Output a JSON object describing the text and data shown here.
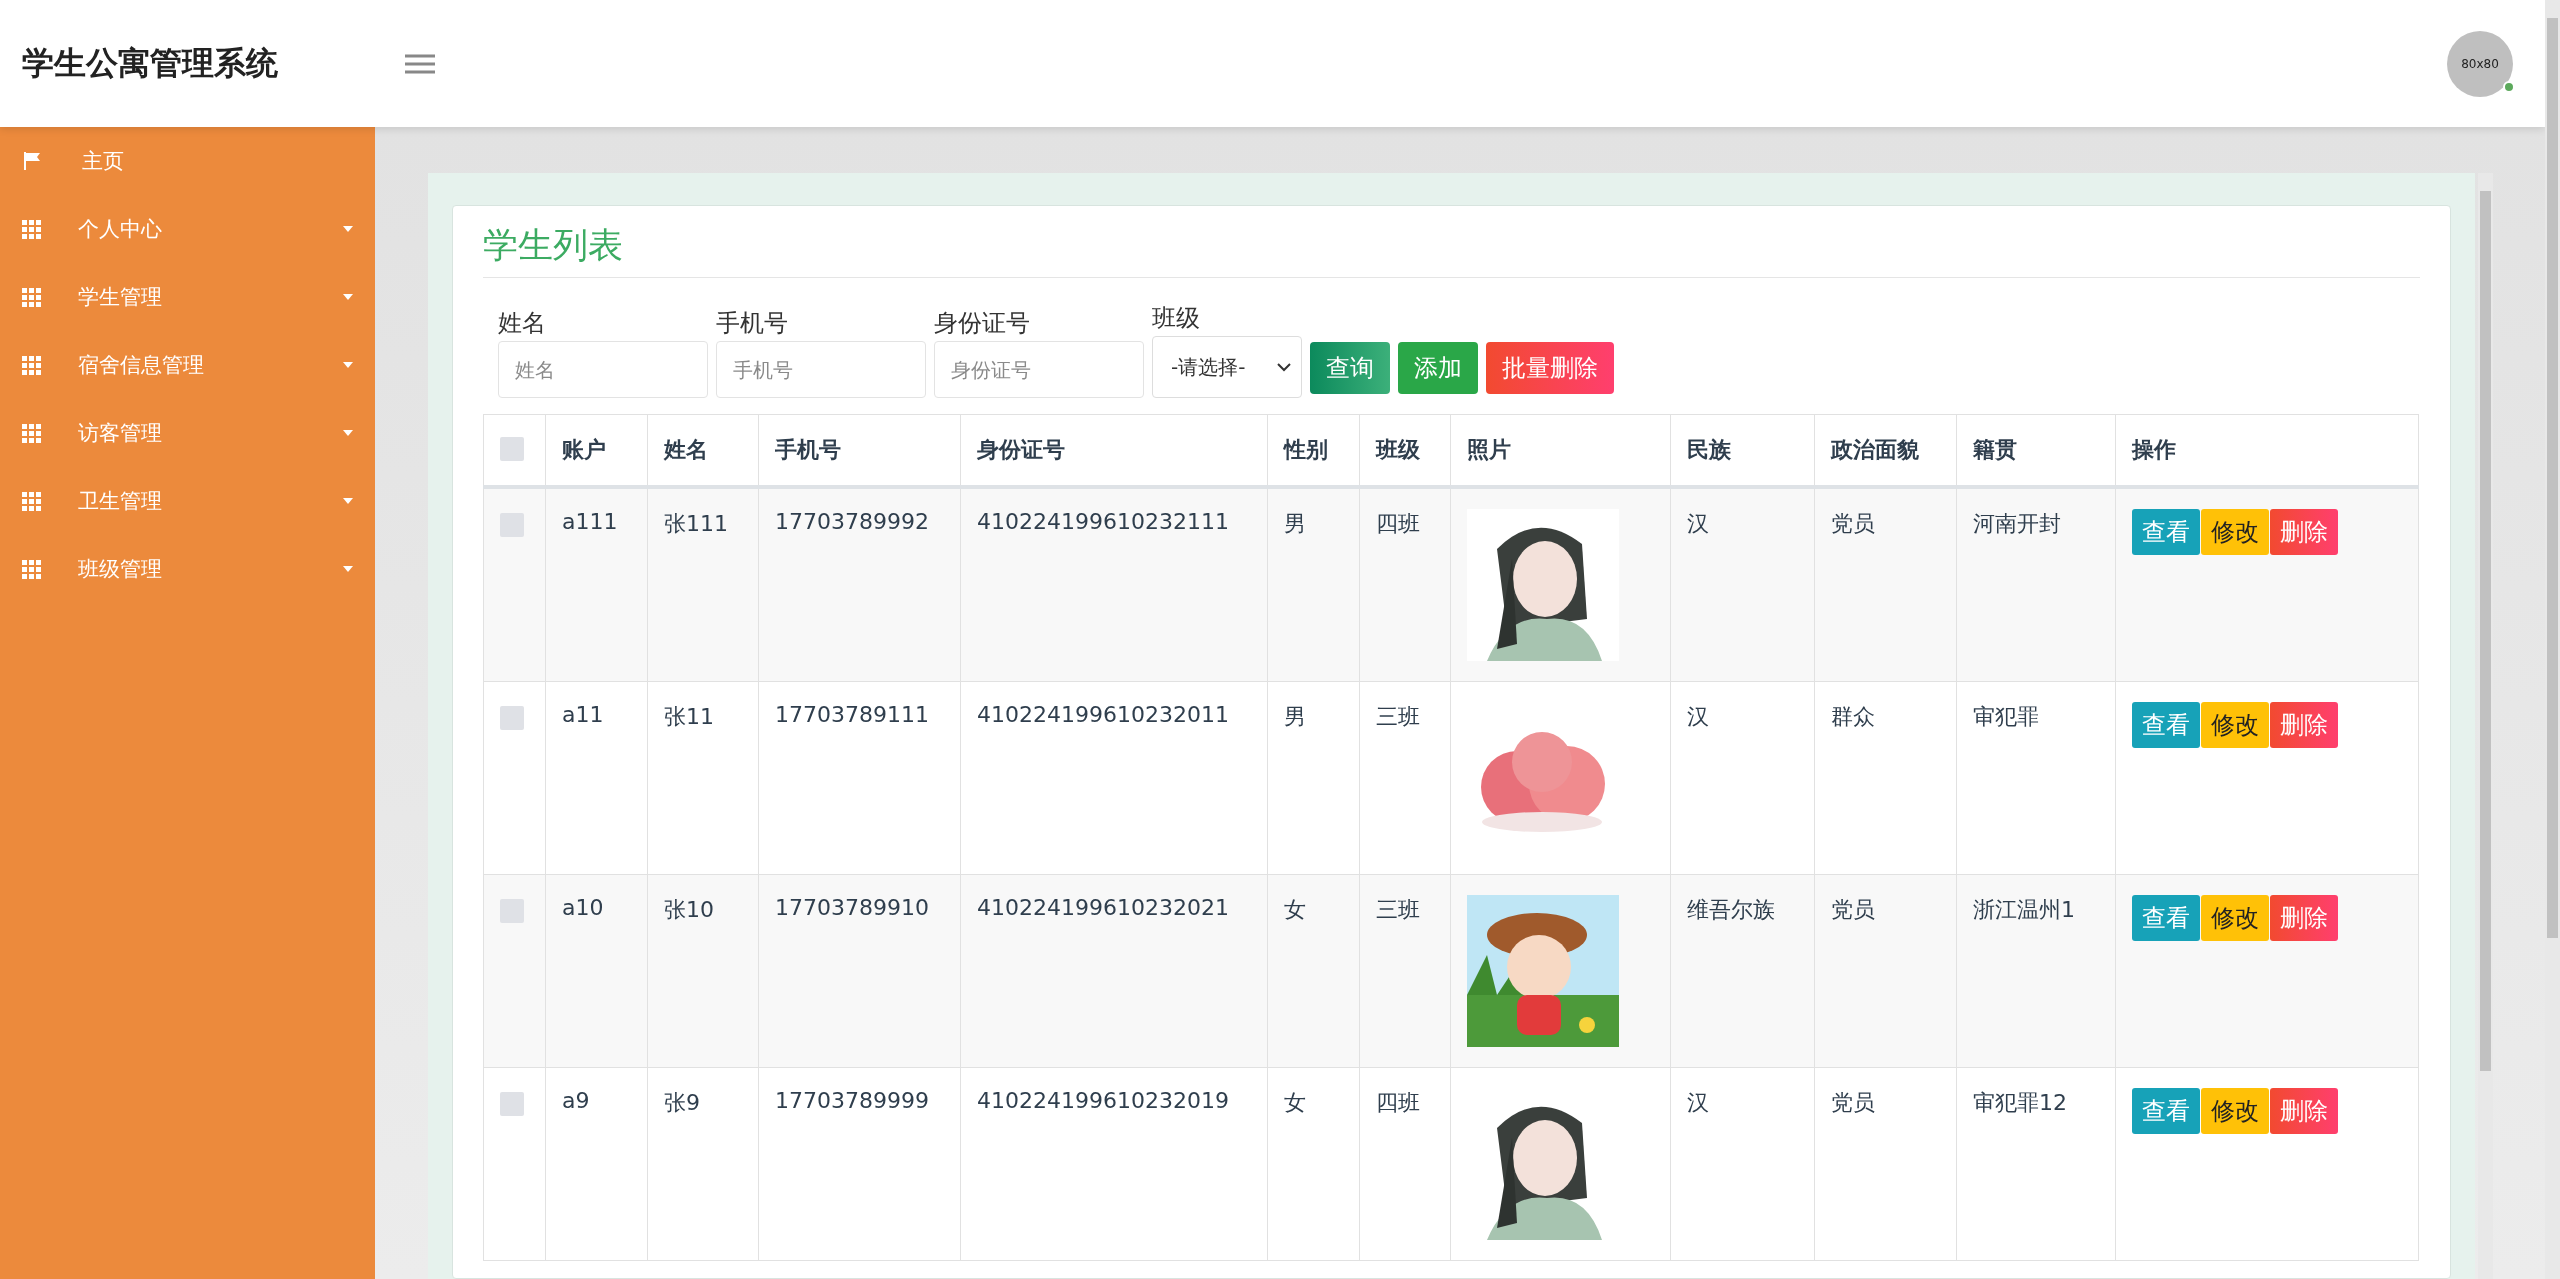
{
  "header": {
    "title": "学生公寓管理系统",
    "avatar": {
      "text": "80x80",
      "online": true
    }
  },
  "sidebar": {
    "items": [
      {
        "label": "主页",
        "kind": "link"
      },
      {
        "label": "个人中心",
        "kind": "submenu"
      },
      {
        "label": "学生管理",
        "kind": "submenu"
      },
      {
        "label": "宿舍信息管理",
        "kind": "submenu"
      },
      {
        "label": "访客管理",
        "kind": "submenu"
      },
      {
        "label": "卫生管理",
        "kind": "submenu"
      },
      {
        "label": "班级管理",
        "kind": "submenu"
      }
    ]
  },
  "page": {
    "title": "学生列表",
    "filters": [
      {
        "label": "姓名",
        "placeholder": "姓名",
        "kind": "input"
      },
      {
        "label": "手机号",
        "placeholder": "手机号",
        "kind": "input"
      },
      {
        "label": "身份证号",
        "placeholder": "身份证号",
        "kind": "input"
      },
      {
        "label": "班级",
        "value": "-请选择-",
        "kind": "select"
      }
    ],
    "buttons": [
      {
        "label": "查询",
        "kind": "search"
      },
      {
        "label": "添加",
        "kind": "add"
      },
      {
        "label": "批量删除",
        "kind": "delete"
      }
    ],
    "table": {
      "select_all_checked": false,
      "columns": [
        "账户",
        "姓名",
        "手机号",
        "身份证号",
        "性别",
        "班级",
        "照片",
        "民族",
        "政治面貌",
        "籍贯",
        "操作"
      ],
      "rows": [
        {
          "checked": false,
          "cells": [
            "a111",
            "张111",
            "17703789992",
            "410224199610232111",
            "男",
            "四班",
            {
              "kind": "picture"
            },
            "汉",
            "党员",
            "河南开封"
          ],
          "actions": [
            "查看",
            "修改",
            "删除"
          ]
        },
        {
          "checked": false,
          "cells": [
            "a11",
            "张11",
            "17703789111",
            "410224199610232011",
            "男",
            "三班",
            {
              "kind": "picture"
            },
            "汉",
            "群众",
            "审犯罪"
          ],
          "actions": [
            "查看",
            "修改",
            "删除"
          ]
        },
        {
          "checked": false,
          "cells": [
            "a10",
            "张10",
            "17703789910",
            "410224199610232021",
            "女",
            "三班",
            {
              "kind": "picture"
            },
            "维吾尔族",
            "党员",
            "浙江温州1"
          ],
          "actions": [
            "查看",
            "修改",
            "删除"
          ]
        },
        {
          "checked": false,
          "cells": [
            "a9",
            "张9",
            "17703789999",
            "410224199610232019",
            "女",
            "四班",
            {
              "kind": "picture"
            },
            "汉",
            "党员",
            "审犯罪12"
          ],
          "actions": [
            "查看",
            "修改",
            "删除"
          ]
        }
      ]
    }
  }
}
